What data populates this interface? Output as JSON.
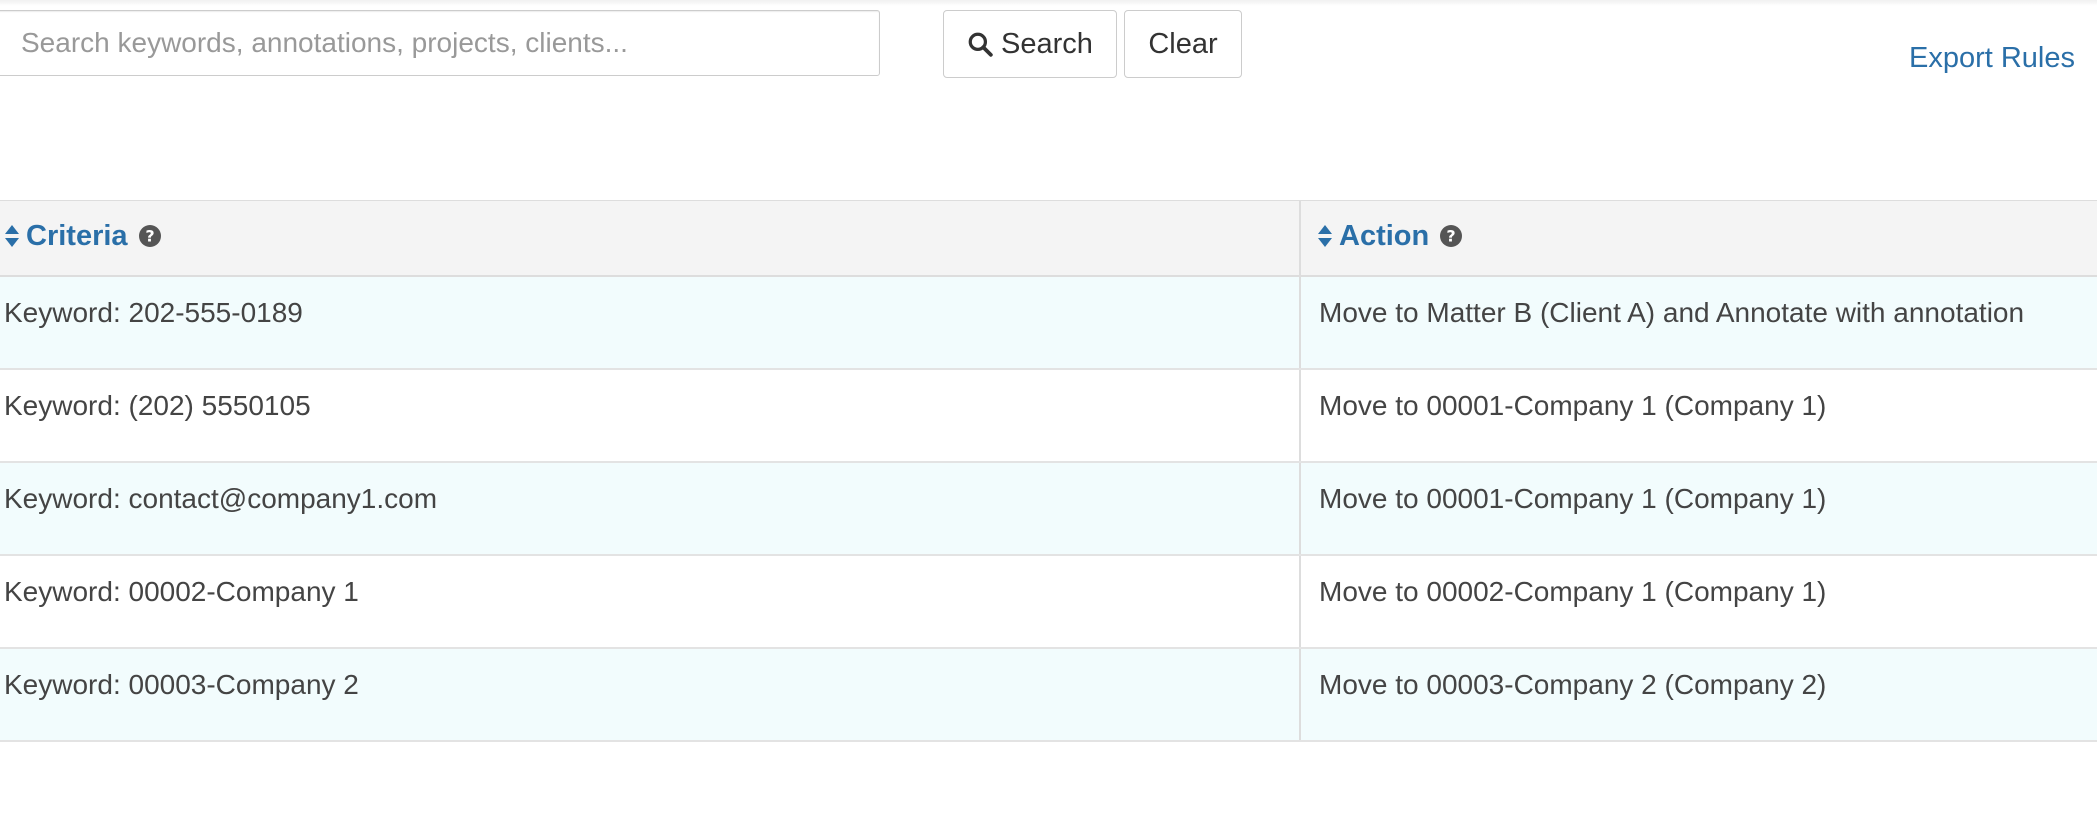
{
  "search": {
    "placeholder": "Search keywords, annotations, projects, clients...",
    "value": ""
  },
  "toolbar": {
    "search_label": "Search",
    "clear_label": "Clear",
    "export_label": "Export Rules"
  },
  "icons": {
    "search": "magnifier-icon",
    "sort": "sort-updown-icon",
    "help": "question-circle-icon"
  },
  "colors": {
    "link": "#2a6fa8",
    "row_stripe": "#f2fcfd",
    "header_bg": "#f4f4f4"
  },
  "table": {
    "columns": [
      {
        "label": "Criteria"
      },
      {
        "label": "Action"
      }
    ],
    "rows": [
      {
        "criteria": "Keyword: 202-555-0189",
        "action": "Move to Matter B (Client A) and Annotate with annotation"
      },
      {
        "criteria": "Keyword: (202) 5550105",
        "action": "Move to 00001-Company 1 (Company 1)"
      },
      {
        "criteria": "Keyword: contact@company1.com",
        "action": "Move to 00001-Company 1 (Company 1)"
      },
      {
        "criteria": "Keyword: 00002-Company 1",
        "action": "Move to 00002-Company 1 (Company 1)"
      },
      {
        "criteria": "Keyword: 00003-Company 2",
        "action": "Move to 00003-Company 2 (Company 2)"
      }
    ]
  }
}
